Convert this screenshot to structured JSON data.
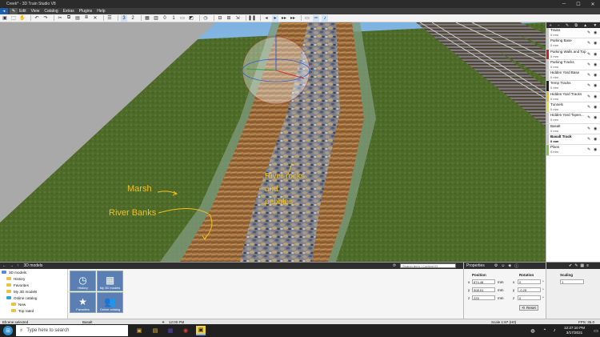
{
  "window": {
    "title": "Creek* - 3D Train Studio V8",
    "controls": [
      "─",
      "☐",
      "✕"
    ]
  },
  "menu": {
    "items": [
      "Edit",
      "View",
      "Catalog",
      "Extras",
      "Plugins",
      "Help"
    ]
  },
  "toolbar": {
    "page_a": "0",
    "page_b": "1"
  },
  "viewport": {
    "annotations": {
      "marsh": "Marsh",
      "river_banks": "River Banks",
      "river_rocks": "River rocks and pebbles"
    }
  },
  "layers": [
    {
      "name": "Trains",
      "size": "0 mm",
      "color": "#c8c8c8"
    },
    {
      "name": "Parking Base",
      "size": "0 mm",
      "color": "#c8c8c8"
    },
    {
      "name": "Parking Walls and Top",
      "size": "0 mm",
      "color": "#d02020"
    },
    {
      "name": "Parking Tracks",
      "size": "0 mm",
      "color": "#c8c8c8"
    },
    {
      "name": "Hidden Yard Base",
      "size": "0 mm",
      "color": "#c8c8c8"
    },
    {
      "name": "Temp Tracks",
      "size": "0 mm",
      "color": "#202020"
    },
    {
      "name": "Hidden Yard Tracks",
      "size": "0 mm",
      "color": "#e8c020"
    },
    {
      "name": "Tunnels",
      "size": "0 mm",
      "color": "#e8e040"
    },
    {
      "name": "Hidden Yard Topen...",
      "size": "0 mm",
      "color": "#c8c8c8"
    },
    {
      "name": "Basalt",
      "size": "0 mm",
      "color": "#c8c8c8"
    },
    {
      "name": "Basalt Track",
      "size": "0 mm",
      "color": "#c8c8c8"
    },
    {
      "name": "Plans",
      "size": "0 mm",
      "color": "#7ac84a"
    }
  ],
  "catalog": {
    "header": "3D models",
    "tree": [
      "3D models",
      "History",
      "Favorites",
      "My 3D models",
      "Online catalog",
      "New",
      "Top rated"
    ],
    "tiles": [
      "History",
      "My 3D models",
      "Favorites",
      "Online catalog"
    ],
    "search_placeholder": "Search term / Content ID"
  },
  "properties": {
    "header": "Properties",
    "position_label": "Position",
    "rotation_label": "Rotation",
    "scaling_label": "Scaling",
    "position": {
      "x": "874.48",
      "y": "908.51",
      "z": "225",
      "unit": "mm"
    },
    "rotation": {
      "x": "0",
      "y": "-0.25",
      "z": "0",
      "unit": "°"
    },
    "scaling": "1",
    "reset_label": "Reset",
    "axes": {
      "x": "x",
      "y": "y",
      "z": "z"
    }
  },
  "status": {
    "left": "Eb:ene selected",
    "mid": "Basalt",
    "time": "12:00 PM",
    "scale": "Scale 1:87 (H0)",
    "fps": "FPS: 35.0"
  },
  "taskbar": {
    "search_placeholder": "Type here to search",
    "clock_time": "12:27:10 PM",
    "clock_date": "3/17/2021"
  },
  "colors": {
    "annotation": "#f0c020",
    "dark": "#2b2b2b",
    "accent": "#1e5ea8"
  }
}
